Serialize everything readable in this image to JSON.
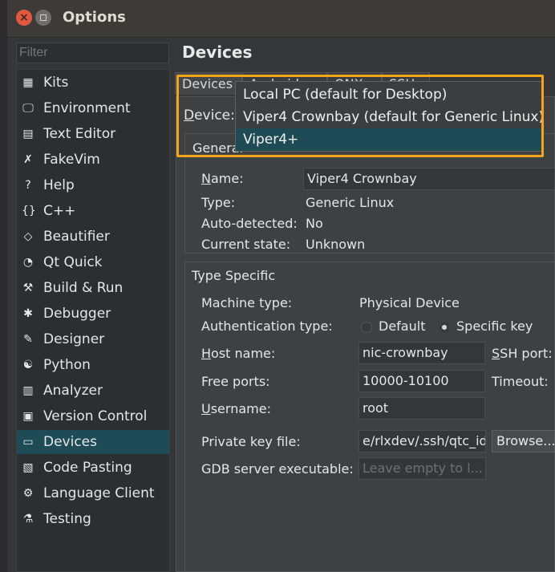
{
  "window": {
    "title": "Options"
  },
  "filter": {
    "placeholder": "Filter"
  },
  "nav": {
    "items": [
      {
        "label": "Kits",
        "icon": "kits-icon",
        "glyph": "▦"
      },
      {
        "label": "Environment",
        "icon": "monitor-icon",
        "glyph": "🖵"
      },
      {
        "label": "Text Editor",
        "icon": "text-editor-icon",
        "glyph": "▤"
      },
      {
        "label": "FakeVim",
        "icon": "fakevim-icon",
        "glyph": "✗"
      },
      {
        "label": "Help",
        "icon": "help-icon",
        "glyph": "?"
      },
      {
        "label": "C++",
        "icon": "braces-icon",
        "glyph": "{}"
      },
      {
        "label": "Beautifier",
        "icon": "diamond-icon",
        "glyph": "◇"
      },
      {
        "label": "Qt Quick",
        "icon": "qtquick-icon",
        "glyph": "◔"
      },
      {
        "label": "Build & Run",
        "icon": "hammer-icon",
        "glyph": "⚒"
      },
      {
        "label": "Debugger",
        "icon": "bug-icon",
        "glyph": "✱"
      },
      {
        "label": "Designer",
        "icon": "pencil-icon",
        "glyph": "✎"
      },
      {
        "label": "Python",
        "icon": "python-icon",
        "glyph": "☯"
      },
      {
        "label": "Analyzer",
        "icon": "analyzer-icon",
        "glyph": "▥"
      },
      {
        "label": "Version Control",
        "icon": "version-control-icon",
        "glyph": "▣"
      },
      {
        "label": "Devices",
        "icon": "devices-icon",
        "glyph": "▭"
      },
      {
        "label": "Code Pasting",
        "icon": "clipboard-icon",
        "glyph": "▧"
      },
      {
        "label": "Language Client",
        "icon": "language-client-icon",
        "glyph": "⚙"
      },
      {
        "label": "Testing",
        "icon": "testing-icon",
        "glyph": "⚗"
      }
    ],
    "selected": "Devices"
  },
  "main": {
    "heading": "Devices",
    "tabs": [
      "Devices",
      "Android",
      "QNX",
      "SSH"
    ],
    "device_label_prefix": "D",
    "device_label_rest": "evice:",
    "general_title": "General",
    "name_label": "Name:",
    "name_value": "Viper4 Crownbay",
    "type_label": "Type:",
    "type_value": "Generic Linux",
    "autodetected_label": "Auto-detected:",
    "autodetected_value": "No",
    "state_label": "Current state:",
    "state_value": "Unknown",
    "type_specific_title": "Type Specific",
    "machine_type_label": "Machine type:",
    "machine_type_value": "Physical Device",
    "auth_label": "Authentication type:",
    "auth_default": "Default",
    "auth_specific": "Specific key",
    "host_label": "Host name:",
    "host_value": "nic-crownbay",
    "ssh_port_label": "SSH port:",
    "free_ports_label": "Free ports:",
    "free_ports_value": "10000-10100",
    "timeout_label": "Timeout:",
    "username_label": "Username:",
    "username_value": "root",
    "private_key_label": "Private key file:",
    "private_key_value": "e/rlxdev/.ssh/qtc_id",
    "browse_label": "Browse...",
    "gdb_label": "GDB server executable:",
    "gdb_placeholder": "Leave empty to l..."
  },
  "dropdown": {
    "options": [
      "Local PC (default for Desktop)",
      "Viper4 Crownbay (default for Generic Linux)",
      "Viper4+"
    ],
    "selected": "Viper4+"
  },
  "colors": {
    "selection": "#1f4b57",
    "highlight_border": "#f2a51a",
    "close_button": "#e2583e"
  }
}
